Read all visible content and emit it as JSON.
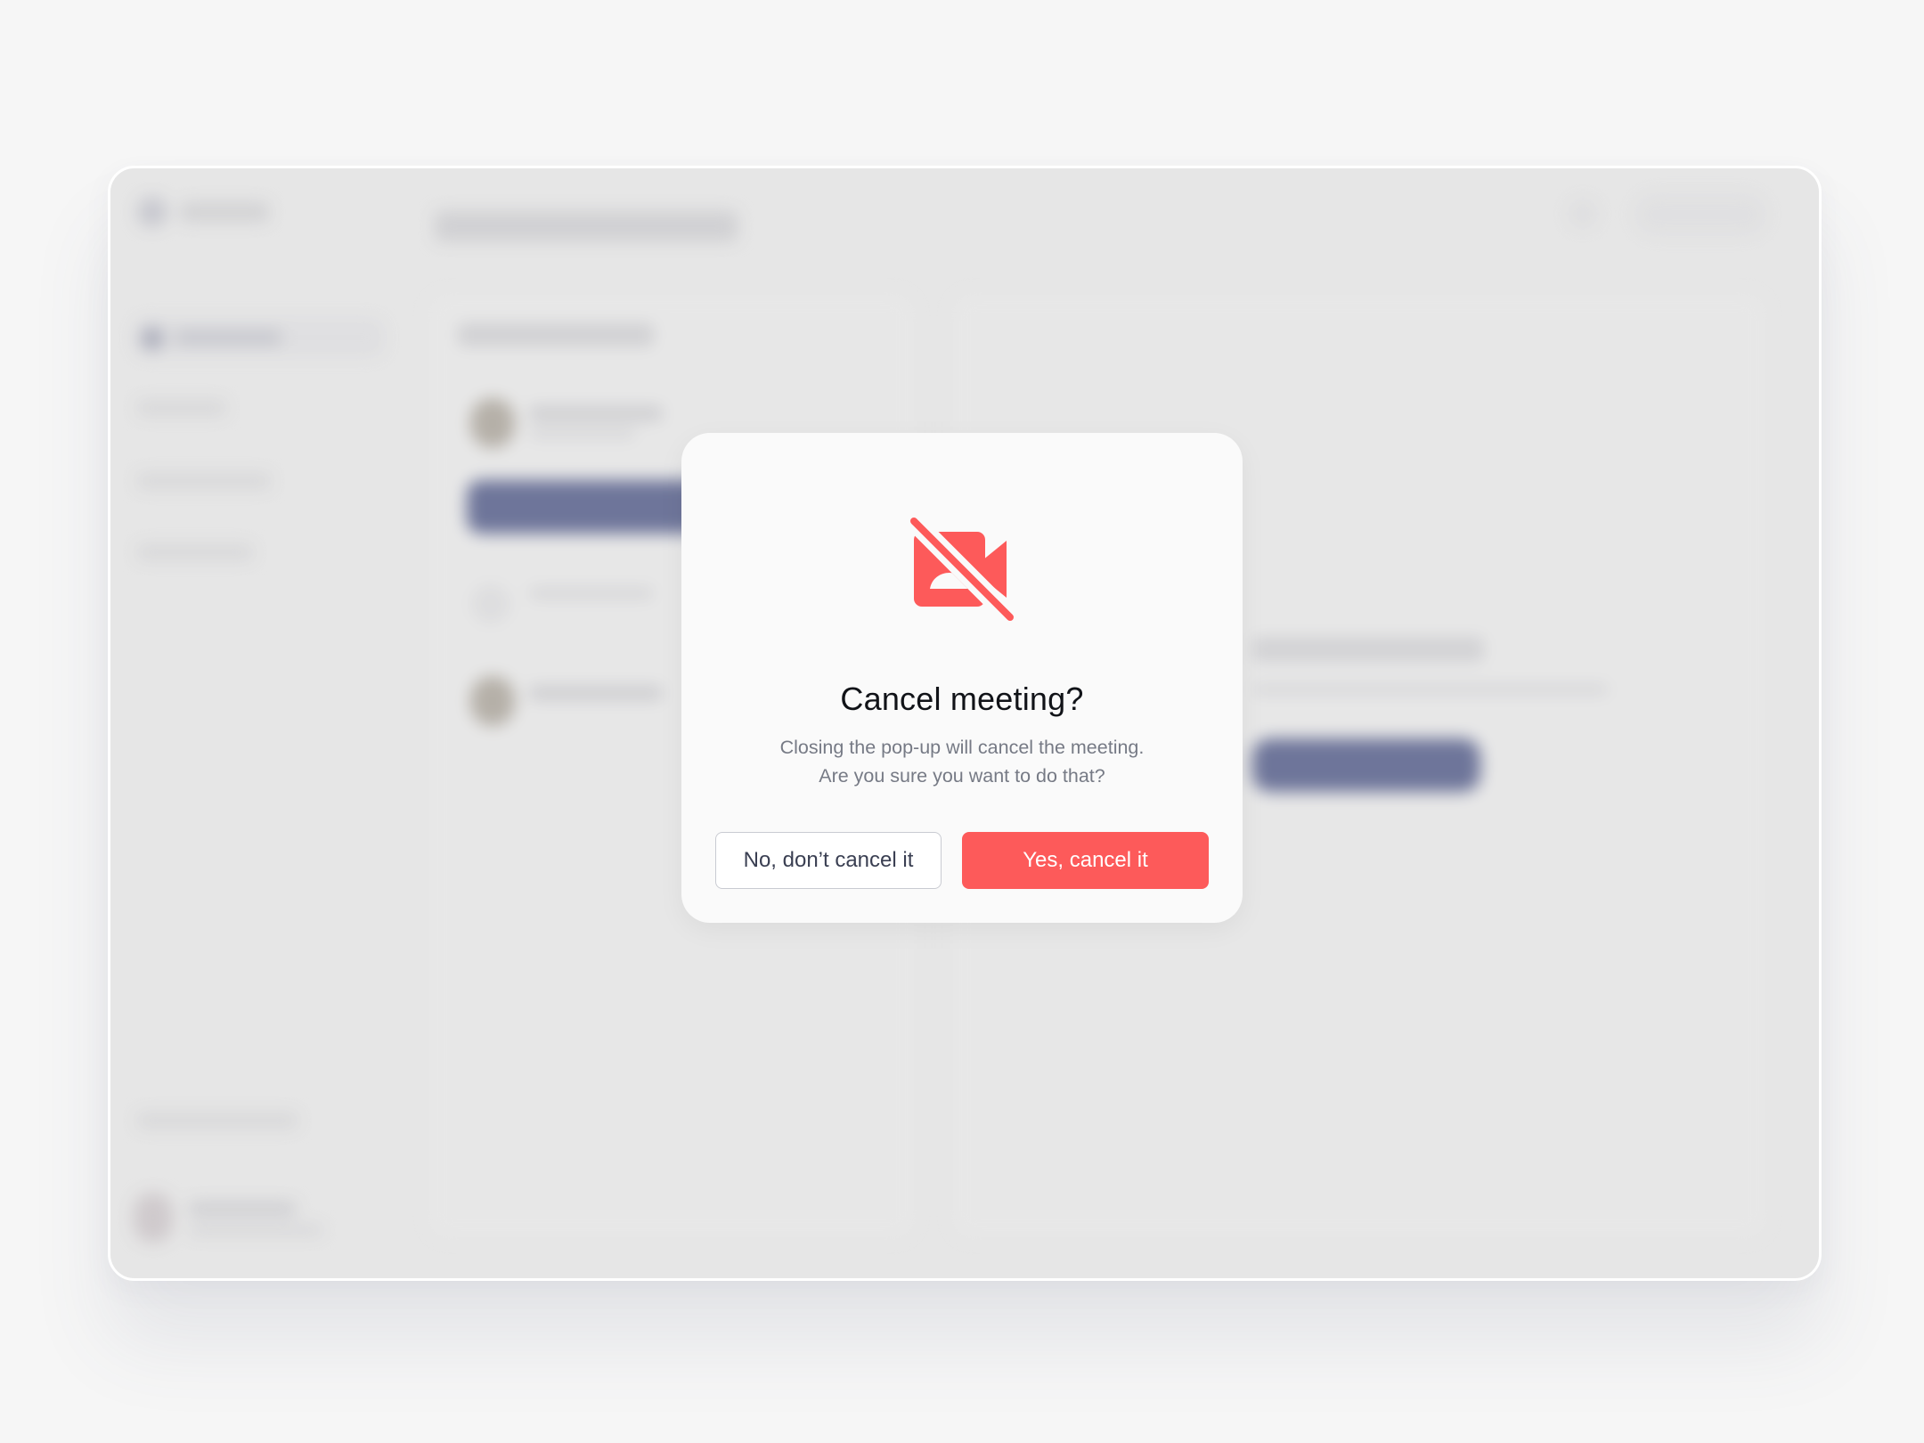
{
  "dialog": {
    "icon": "video-off-icon",
    "title": "Cancel meeting?",
    "body_line1": "Closing the pop-up will cancel the meeting.",
    "body_line2": "Are you sure you want to do that?",
    "secondary_label": "No, don’t cancel it",
    "primary_label": "Yes, cancel it"
  },
  "colors": {
    "danger": "#fd5a5a",
    "title_text": "#111318",
    "body_text": "#767a85",
    "page_background": "#f6f6f6",
    "app_background": "#e6e6e6",
    "accent_navy": "#2f3a72"
  }
}
